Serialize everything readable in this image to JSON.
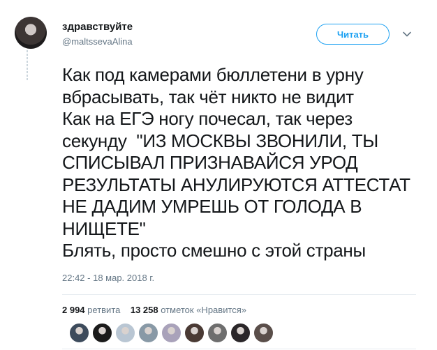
{
  "author": {
    "display_name": "здравствуйте",
    "handle": "@maltssevaAlina"
  },
  "follow_button": {
    "label": "Читать"
  },
  "tweet": {
    "text": "Как под камерами бюллетени в урну\nвбрасывать, так чёт никто не видит\nКак на ЕГЭ ногу почесал, так через\nсекунду  \"ИЗ МОСКВЫ ЗВОНИЛИ, ТЫ\nСПИСЫВАЛ ПРИЗНАВАЙСЯ УРОД\nРЕЗУЛЬТАТЫ АНУЛИРУЮТСЯ АТТЕСТАТ\nНЕ ДАДИМ УМРЕШЬ ОТ ГОЛОДА В\nНИЩЕТЕ\"\nБлять, просто смешно с этой страны",
    "timestamp": "22:42 - 18 мар. 2018 г."
  },
  "stats": {
    "retweets_count": "2 994",
    "retweets_label": "ретвита",
    "likes_count": "13 258",
    "likes_label": "отметок «Нравится»"
  },
  "likers": [
    {
      "name": "liker-avatar-1",
      "color": "#3d4b5c"
    },
    {
      "name": "liker-avatar-2",
      "color": "#1b1b1b"
    },
    {
      "name": "liker-avatar-3",
      "color": "#b9c6d3"
    },
    {
      "name": "liker-avatar-4",
      "color": "#8899a6"
    },
    {
      "name": "liker-avatar-5",
      "color": "#a9a2ba"
    },
    {
      "name": "liker-avatar-6",
      "color": "#4a3a34"
    },
    {
      "name": "liker-avatar-7",
      "color": "#6e6e6e"
    },
    {
      "name": "liker-avatar-8",
      "color": "#2a2629"
    },
    {
      "name": "liker-avatar-9",
      "color": "#5a4e4a"
    }
  ],
  "icons": {
    "caret": "chevron-down-icon"
  },
  "colors": {
    "accent": "#1da1f2",
    "text": "#14171a",
    "muted": "#657786",
    "border": "#e6ecf0"
  }
}
